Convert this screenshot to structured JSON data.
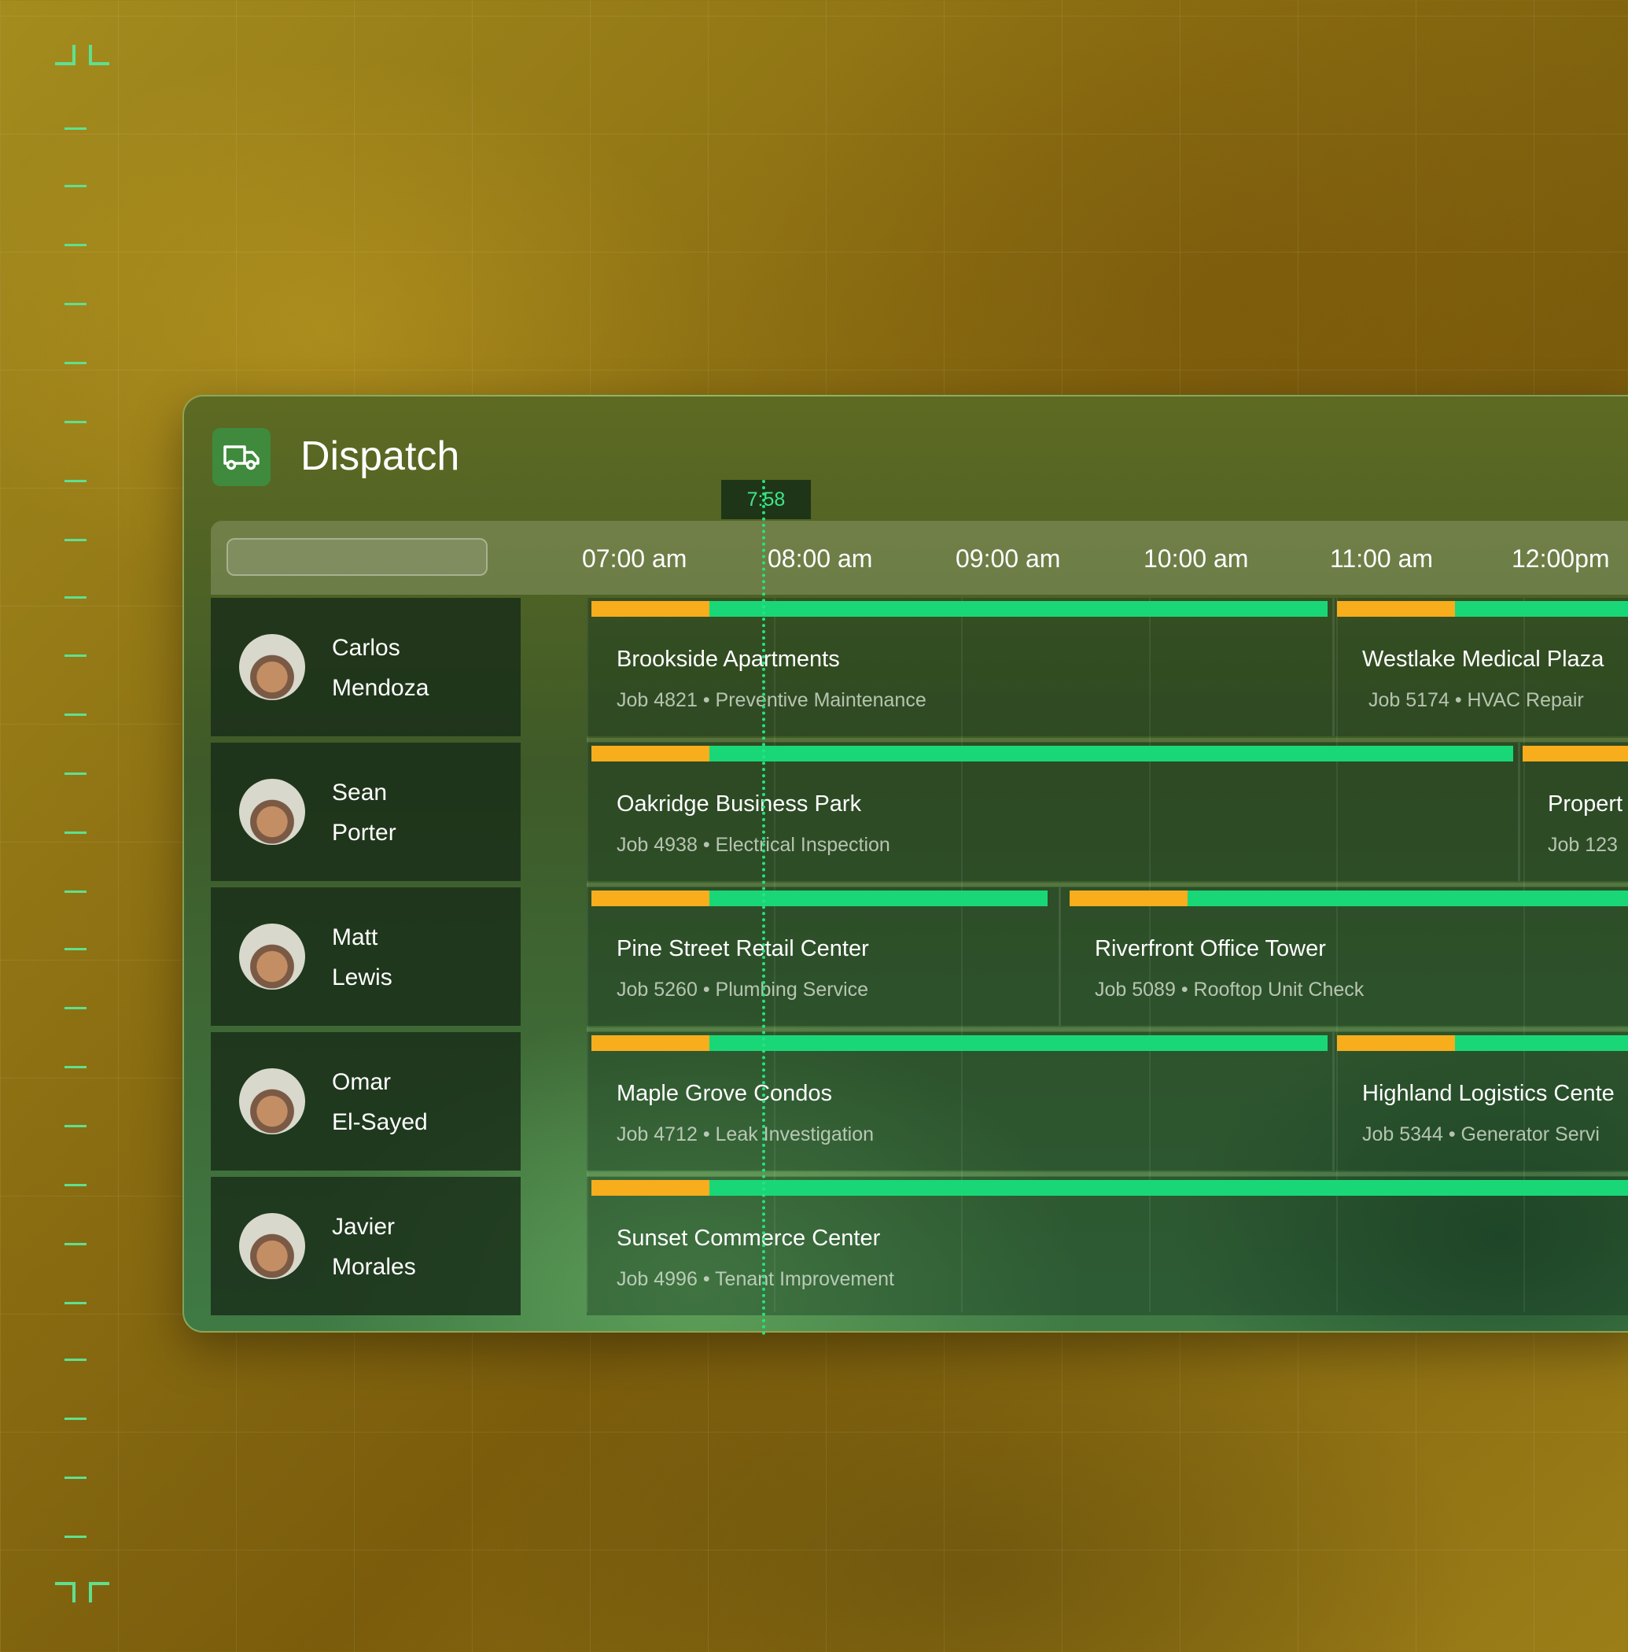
{
  "app": {
    "title": "Dispatch",
    "icon": "truck-icon"
  },
  "now_marker": {
    "label": "7:58"
  },
  "search": {
    "placeholder": ""
  },
  "timeline": {
    "hours": [
      "07:00 am",
      "08:00 am",
      "09:00 am",
      "10:00 am",
      "11:00 am",
      "12:00pm"
    ]
  },
  "colors": {
    "accent": "#19d777",
    "travel": "#f7ad1c",
    "ruler": "#5fe08f"
  },
  "technicians": [
    {
      "first": "Carlos",
      "last": "Mendoza"
    },
    {
      "first": "Sean",
      "last": "Porter"
    },
    {
      "first": "Matt",
      "last": "Lewis"
    },
    {
      "first": "Omar",
      "last": "El-Sayed"
    },
    {
      "first": "Javier",
      "last": "Morales"
    }
  ],
  "jobs": {
    "carlos": [
      {
        "title": "Brookside Apartments",
        "sub": "Job 4821 • Preventive Maintenance"
      },
      {
        "title": "Westlake Medical Plaza",
        "sub": "Job 5174 • HVAC Repair"
      }
    ],
    "sean": [
      {
        "title": "Oakridge Business Park",
        "sub": "Job 4938 • Electrical Inspection"
      },
      {
        "title": "Propert",
        "sub": "Job 123"
      }
    ],
    "matt": [
      {
        "title": "Pine Street Retail Center",
        "sub": "Job 5260 • Plumbing Service"
      },
      {
        "title": "Riverfront Office Tower",
        "sub": "Job 5089 • Rooftop Unit Check"
      }
    ],
    "omar": [
      {
        "title": "Maple Grove Condos",
        "sub": "Job 4712 • Leak Investigation"
      },
      {
        "title": "Highland Logistics Cente",
        "sub": "Job 5344 • Generator Servi"
      }
    ],
    "javier": [
      {
        "title": "Sunset Commerce Center",
        "sub": "Job 4996 • Tenant Improvement"
      }
    ]
  }
}
